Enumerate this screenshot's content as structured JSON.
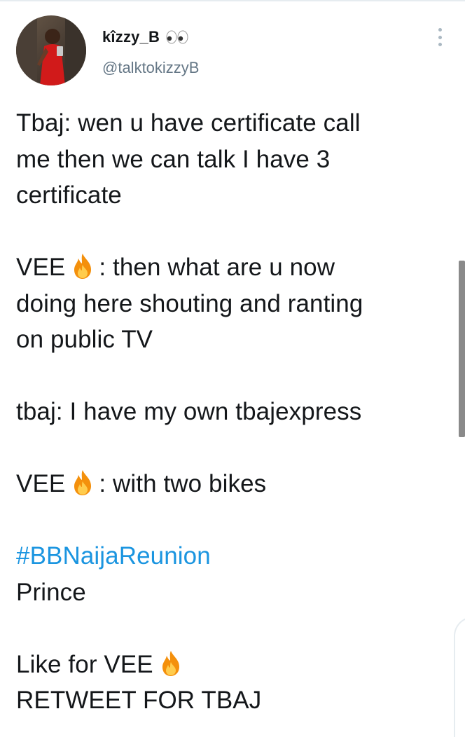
{
  "author": {
    "display_name": "kîzzy_B",
    "handle": "@talktokizzyB",
    "badge_icon": "eyes-emoji",
    "avatar_icon": "profile-photo"
  },
  "tweet": {
    "lines": [
      "Tbaj: wen u have certificate call",
      "me then we can talk I have 3",
      "certificate",
      "",
      "VEE",
      ": then what are u now",
      "doing here shouting and ranting",
      "on public TV",
      "",
      "tbaj: I have my own tbajexpress",
      "",
      "VEE",
      ": with two bikes",
      "",
      "#BBNaijaReunion",
      "Prince",
      "",
      "Like for VEE",
      "RETWEET FOR TBAJ"
    ]
  },
  "colors": {
    "hashtag": "#1b95e0",
    "text": "#14171a",
    "secondary": "#657786"
  }
}
